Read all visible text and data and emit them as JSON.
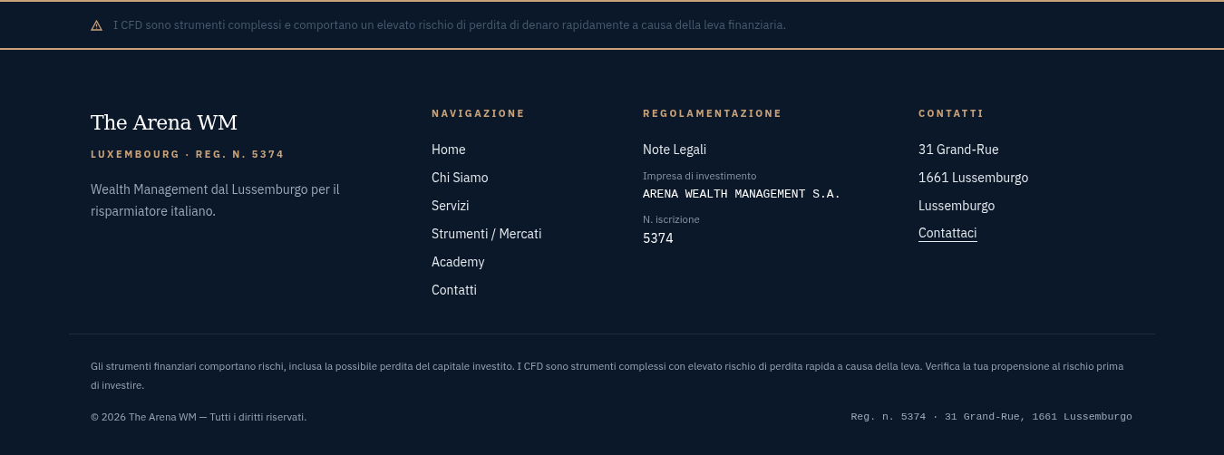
{
  "risk_banner": {
    "text": "I CFD sono strumenti complessi e comportano un elevato rischio di perdita di denaro rapidamente a causa della leva finanziaria."
  },
  "brand": {
    "name": "The Arena WM",
    "tagline": "LUXEMBOURG · REG. N. 5374",
    "description": "Wealth Management dal Lussemburgo per il risparmiatore italiano."
  },
  "columns": [
    {
      "heading": "NAVIGAZIONE",
      "items": [
        {
          "kind": "link",
          "text": "Home"
        },
        {
          "kind": "link",
          "text": "Chi Siamo"
        },
        {
          "kind": "link",
          "text": "Servizi"
        },
        {
          "kind": "link",
          "text": "Strumenti / Mercati"
        },
        {
          "kind": "link",
          "text": "Academy"
        },
        {
          "kind": "link",
          "text": "Contatti"
        }
      ]
    },
    {
      "heading": "REGOLAMENTAZIONE",
      "items": [
        {
          "kind": "link",
          "text": "Note Legali"
        },
        {
          "kind": "label",
          "text": "Impresa di investimento"
        },
        {
          "kind": "code",
          "text": "ARENA WEALTH MANAGEMENT S.A."
        },
        {
          "kind": "label",
          "text": "N. iscrizione"
        },
        {
          "kind": "value",
          "text": "5374"
        }
      ]
    },
    {
      "heading": "CONTATTI",
      "items": [
        {
          "kind": "text",
          "text": "31 Grand-Rue"
        },
        {
          "kind": "text",
          "text": "1661 Lussemburgo"
        },
        {
          "kind": "text",
          "text": "Lussemburgo"
        },
        {
          "kind": "underlined-link",
          "text": "Contattaci"
        }
      ]
    }
  ],
  "disclaimer": "Gli strumenti finanziari comportano rischi, inclusa la possibile perdita del capitale investito. I CFD sono strumenti complessi con elevato rischio di perdita rapida a causa della leva. Verifica la tua propensione al rischio prima di investire.",
  "copyright": "© 2026 The Arena WM — Tutti i diritti riservati.",
  "registration": "Reg. n. 5374 · 31 Grand-Rue, 1661 Lussemburgo"
}
